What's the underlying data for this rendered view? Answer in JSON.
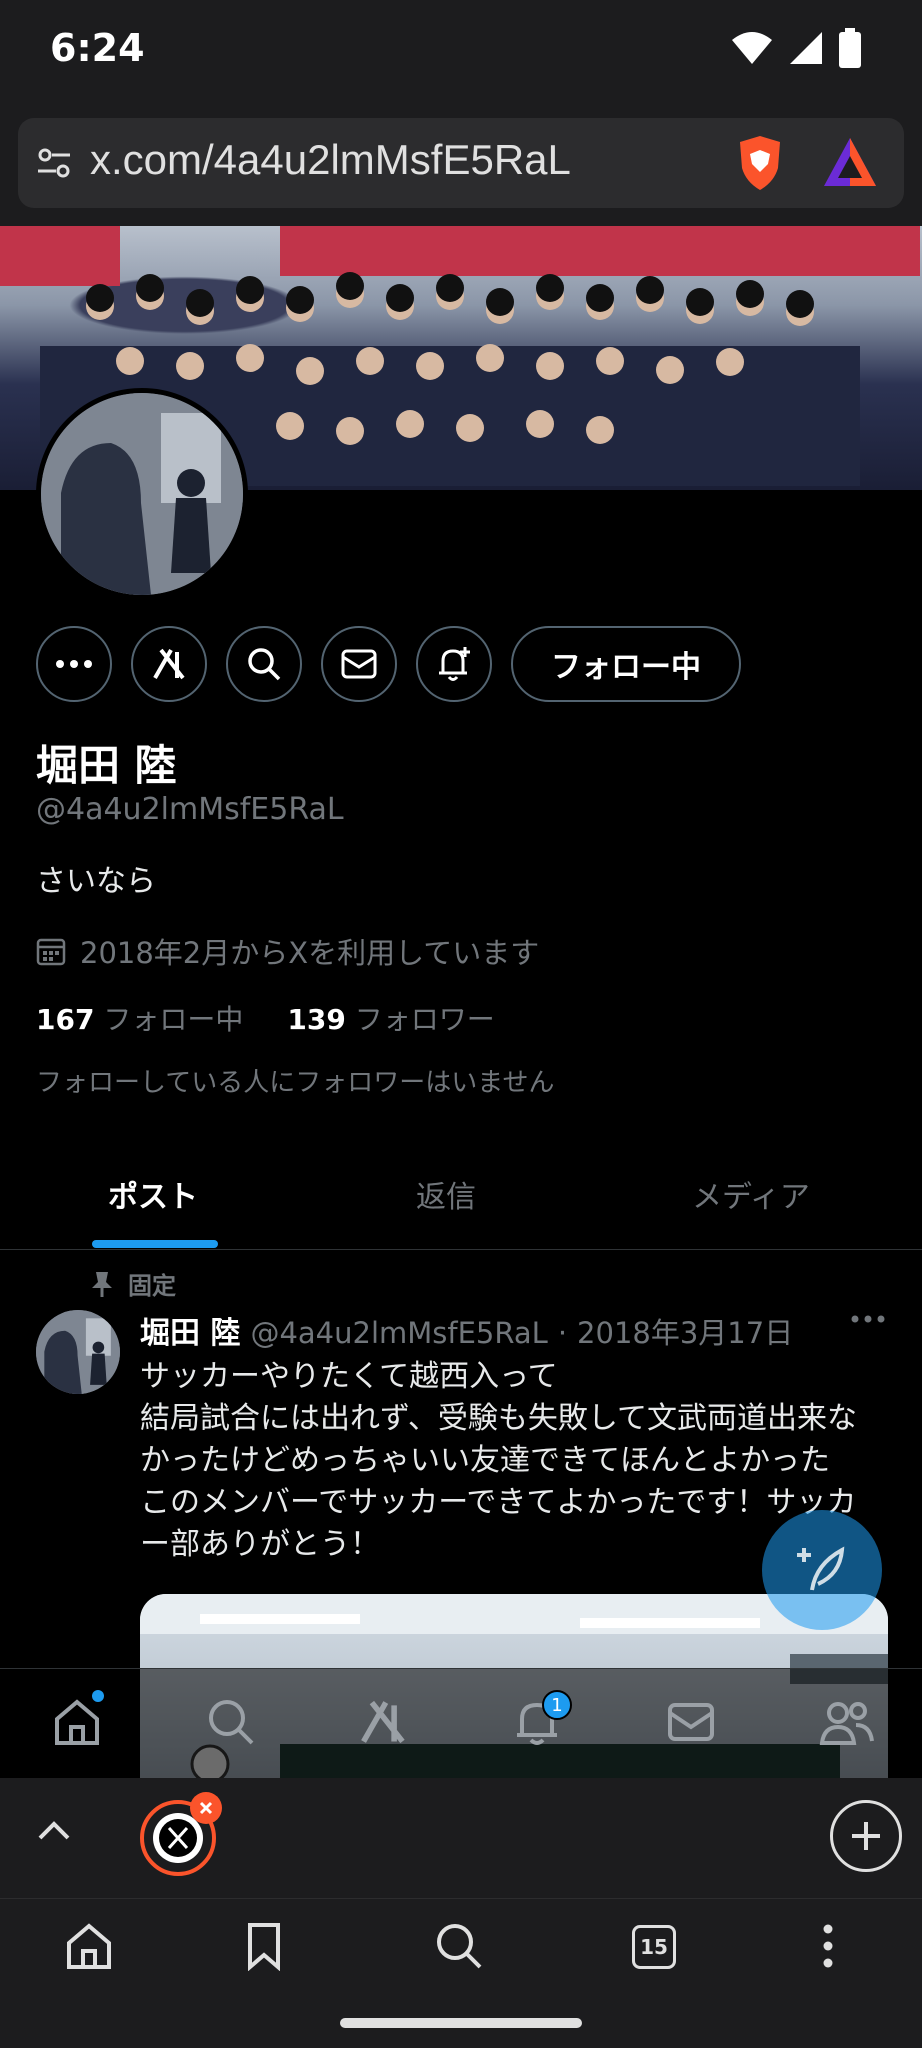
{
  "status_bar": {
    "time": "6:24"
  },
  "browser": {
    "url": "x.com/4a4u2lmMsfE5RaL"
  },
  "profile": {
    "display_name": "堀田 陸",
    "handle": "@4a4u2lmMsfE5RaL",
    "bio": "さいなら",
    "joined": "2018年2月からXを利用しています",
    "following_count": "167",
    "following_label": "フォロー中",
    "followers_count": "139",
    "followers_label": "フォロワー",
    "mutual_note": "フォローしている人にフォロワーはいません",
    "follow_button_label": "フォロー中"
  },
  "tabs": [
    {
      "label": "ポスト",
      "active": true
    },
    {
      "label": "返信",
      "active": false
    },
    {
      "label": "メディア",
      "active": false
    }
  ],
  "pinned_post": {
    "pinned_label": "固定",
    "author_name": "堀田 陸",
    "author_handle": "@4a4u2lmMsfE5RaL",
    "separator": "·",
    "date": "2018年3月17日",
    "text_lines": [
      "サッカーやりたくて越西入って",
      "結局試合には出れず、受験も失敗して文武両道出来な",
      "かったけどめっちゃいい友達できてほんとよかった",
      "このメンバーでサッカーできてよかったです！サッカ",
      "ー部ありがとう！"
    ]
  },
  "x_nav": {
    "notification_badge": "1"
  },
  "brave_toolbar": {
    "tab_count": "15"
  },
  "colors": {
    "accent": "#1d9bf0",
    "brave_orange": "#fb542b",
    "muted": "#71767b"
  }
}
